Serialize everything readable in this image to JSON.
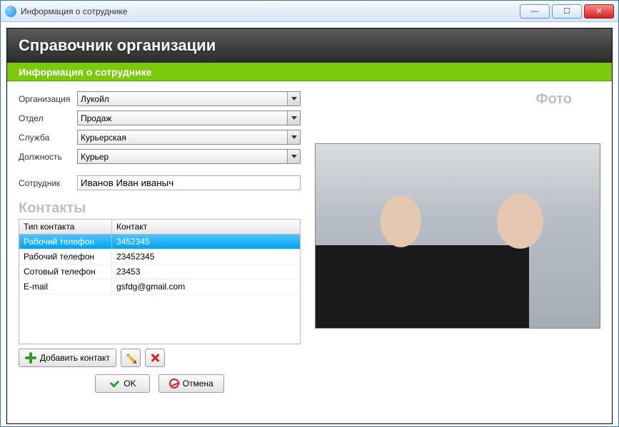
{
  "window": {
    "title": "Информация о сотруднике"
  },
  "header": {
    "title": "Справочник организации",
    "subtitle": "Информация о сотруднике"
  },
  "form": {
    "org_label": "Организация",
    "org_value": "Лукойл",
    "dept_label": "Отдел",
    "dept_value": "Продаж",
    "service_label": "Служба",
    "service_value": "Курьерская",
    "position_label": "Должность",
    "position_value": "Курьер",
    "employee_label": "Сотрудник",
    "employee_value": "Иванов Иван иваныч"
  },
  "contacts": {
    "title": "Контакты",
    "columns": {
      "type": "Тип контакта",
      "value": "Контакт"
    },
    "rows": [
      {
        "type": "Рабочий телефон",
        "value": "3452345",
        "selected": true
      },
      {
        "type": "Рабочий телефон",
        "value": "23452345",
        "selected": false
      },
      {
        "type": "Сотовый телефон",
        "value": "23453",
        "selected": false
      },
      {
        "type": "E-mail",
        "value": "gsfdg@gmail.com",
        "selected": false
      }
    ],
    "add_label": "Добавить контакт"
  },
  "photo": {
    "title": "Фото"
  },
  "buttons": {
    "ok": "OK",
    "cancel": "Отмена"
  }
}
